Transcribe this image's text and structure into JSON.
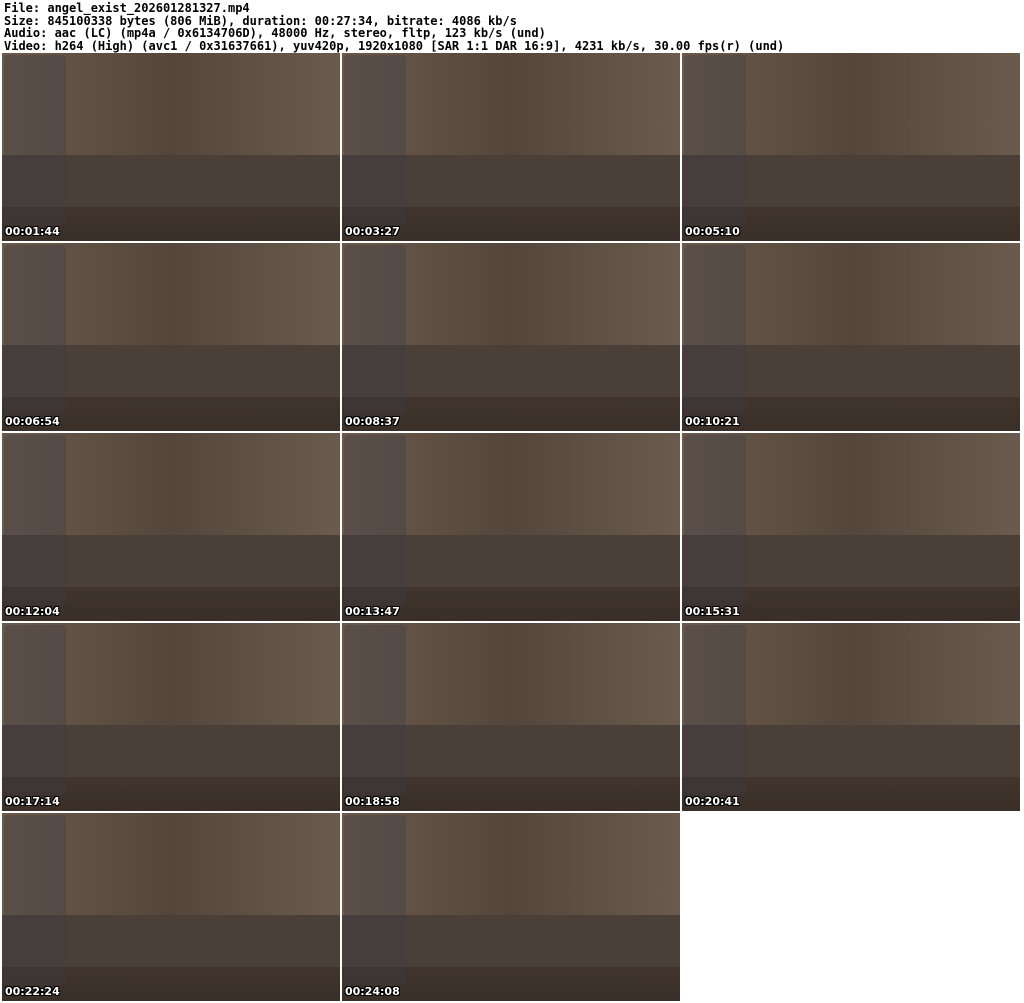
{
  "header": {
    "file": "File: angel_exist_202601281327.mp4",
    "size": "Size: 845100338 bytes (806 MiB), duration: 00:27:34, bitrate: 4086 kb/s",
    "audio": "Audio: aac (LC) (mp4a / 0x6134706D), 48000 Hz, stereo, fltp, 123 kb/s (und)",
    "video": "Video: h264 (High) (avc1 / 0x31637661), yuv420p, 1920x1080 [SAR 1:1 DAR 16:9], 4231 kb/s, 30.00 fps(r) (und)"
  },
  "frames": [
    {
      "timestamp": "00:01:44"
    },
    {
      "timestamp": "00:03:27"
    },
    {
      "timestamp": "00:05:10"
    },
    {
      "timestamp": "00:06:54"
    },
    {
      "timestamp": "00:08:37"
    },
    {
      "timestamp": "00:10:21"
    },
    {
      "timestamp": "00:12:04"
    },
    {
      "timestamp": "00:13:47"
    },
    {
      "timestamp": "00:15:31"
    },
    {
      "timestamp": "00:17:14"
    },
    {
      "timestamp": "00:18:58"
    },
    {
      "timestamp": "00:20:41"
    },
    {
      "timestamp": "00:22:24"
    },
    {
      "timestamp": "00:24:08"
    }
  ]
}
